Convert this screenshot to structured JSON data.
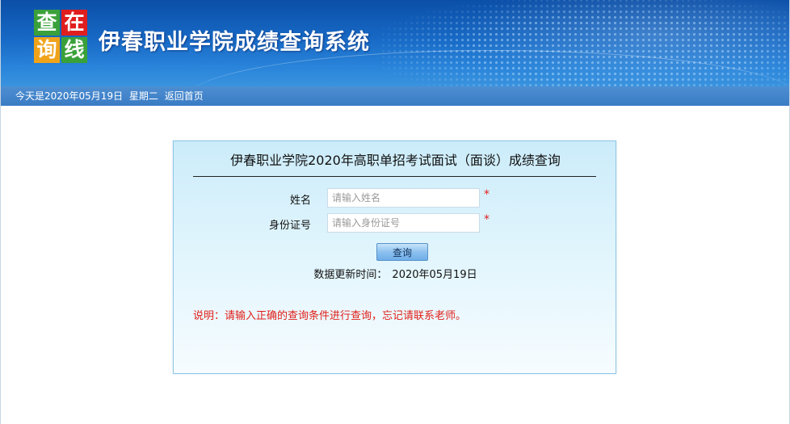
{
  "header": {
    "logo_chars": [
      "查",
      "在",
      "询",
      "线"
    ],
    "system_title": "伊春职业学院成绩查询系统"
  },
  "infobar": {
    "today_prefix": "今天是2020年05月19日",
    "weekday": "星期二",
    "home_link": "返回首页"
  },
  "query_form": {
    "title": "伊春职业学院2020年高职单招考试面试（面谈）成绩查询",
    "name_label": "姓名",
    "name_placeholder": "请输入姓名",
    "name_value": "",
    "id_label": "身份证号",
    "id_placeholder": "请输入身份证号",
    "id_value": "",
    "required_mark": "*",
    "submit_label": "查询",
    "update_label": "数据更新时间：",
    "update_date": "2020年05月19日",
    "note": "说明：请输入正确的查询条件进行查询，忘记请联系老师。"
  },
  "colors": {
    "banner": "#1769c5",
    "infobar": "#3a7cc4",
    "required": "#e0201a",
    "card_border": "#8fc7e6"
  }
}
